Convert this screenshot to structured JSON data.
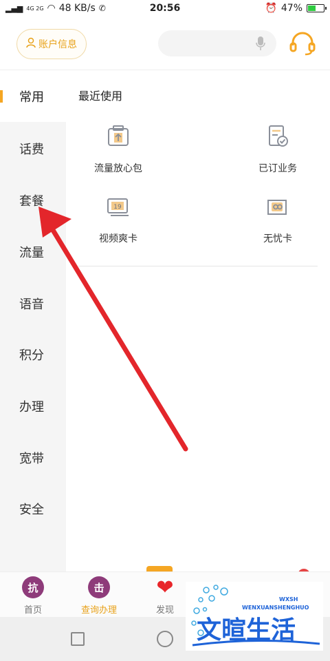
{
  "status_bar": {
    "network": "4G 2G",
    "speed": "48 KB/s",
    "time": "20:56",
    "battery": "47%",
    "battery_level": 0.47
  },
  "header": {
    "account_button": "账户信息"
  },
  "sidebar": {
    "items": [
      {
        "label": "常用",
        "active": true
      },
      {
        "label": "话费"
      },
      {
        "label": "套餐"
      },
      {
        "label": "流量"
      },
      {
        "label": "语音"
      },
      {
        "label": "积分"
      },
      {
        "label": "办理"
      },
      {
        "label": "宽带"
      },
      {
        "label": "安全"
      }
    ]
  },
  "main": {
    "section_title": "最近使用",
    "tiles": [
      {
        "label": "流量放心包",
        "icon": "package-icon"
      },
      {
        "label": "已订业务",
        "icon": "subscribed-doc-icon"
      },
      {
        "label": "视频爽卡",
        "icon": "video-card-icon"
      },
      {
        "label": "无忧卡",
        "icon": "sim-card-icon"
      }
    ]
  },
  "bottom_nav": {
    "items": [
      {
        "label": "首页",
        "glyph": "抗",
        "color": "#8e3b7a"
      },
      {
        "label": "查询办理",
        "glyph": "击",
        "color": "#8e3b7a",
        "active": true
      },
      {
        "label": "发现",
        "glyph": "❤",
        "color": "#e8262a"
      }
    ]
  },
  "watermark": {
    "text": "文暄生活",
    "sub": "WENXUANSHENGHUO",
    "tag": "WXSH"
  },
  "colors": {
    "accent": "#f5a623",
    "arrow": "#e3262b"
  }
}
